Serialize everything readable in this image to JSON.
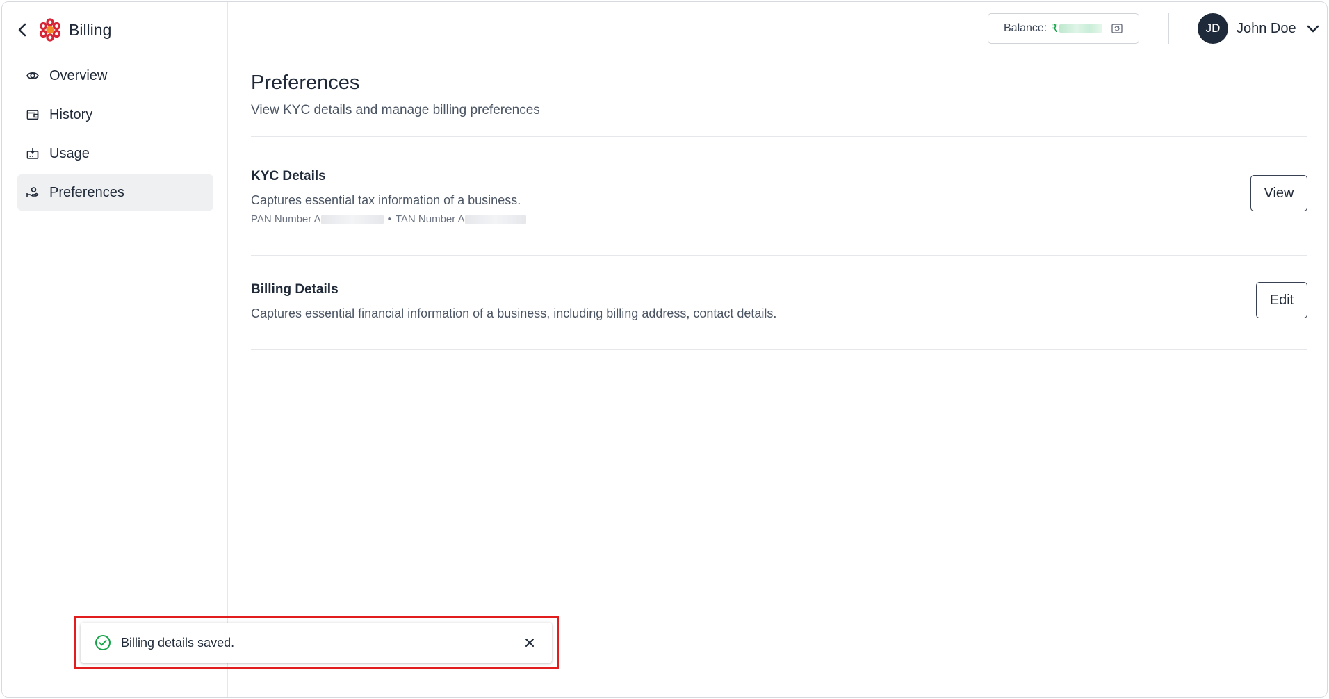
{
  "app": {
    "title": "Billing"
  },
  "sidebar": {
    "items": [
      {
        "label": "Overview",
        "icon": "eye-icon",
        "active": false
      },
      {
        "label": "History",
        "icon": "wallet-icon",
        "active": false
      },
      {
        "label": "Usage",
        "icon": "usage-icon",
        "active": false
      },
      {
        "label": "Preferences",
        "icon": "preferences-icon",
        "active": true
      }
    ]
  },
  "header": {
    "balance_label": "Balance:",
    "currency_symbol": "₹",
    "user": {
      "initials": "JD",
      "name": "John Doe"
    }
  },
  "main": {
    "title": "Preferences",
    "subtitle": "View KYC details and manage billing preferences",
    "kyc": {
      "title": "KYC Details",
      "description": "Captures essential tax information of a business.",
      "pan_label": "PAN Number A",
      "separator": "•",
      "tan_label": "TAN Number A",
      "button_label": "View"
    },
    "billing": {
      "title": "Billing Details",
      "description": "Captures essential financial information of a business, including billing address, contact details.",
      "button_label": "Edit"
    }
  },
  "toast": {
    "message": "Billing details saved."
  },
  "colors": {
    "accent_red": "#e11d1d",
    "success_green": "#16a34a",
    "avatar_bg": "#1e2a3a",
    "logo_red": "#d72638",
    "logo_orange": "#f28c28"
  }
}
